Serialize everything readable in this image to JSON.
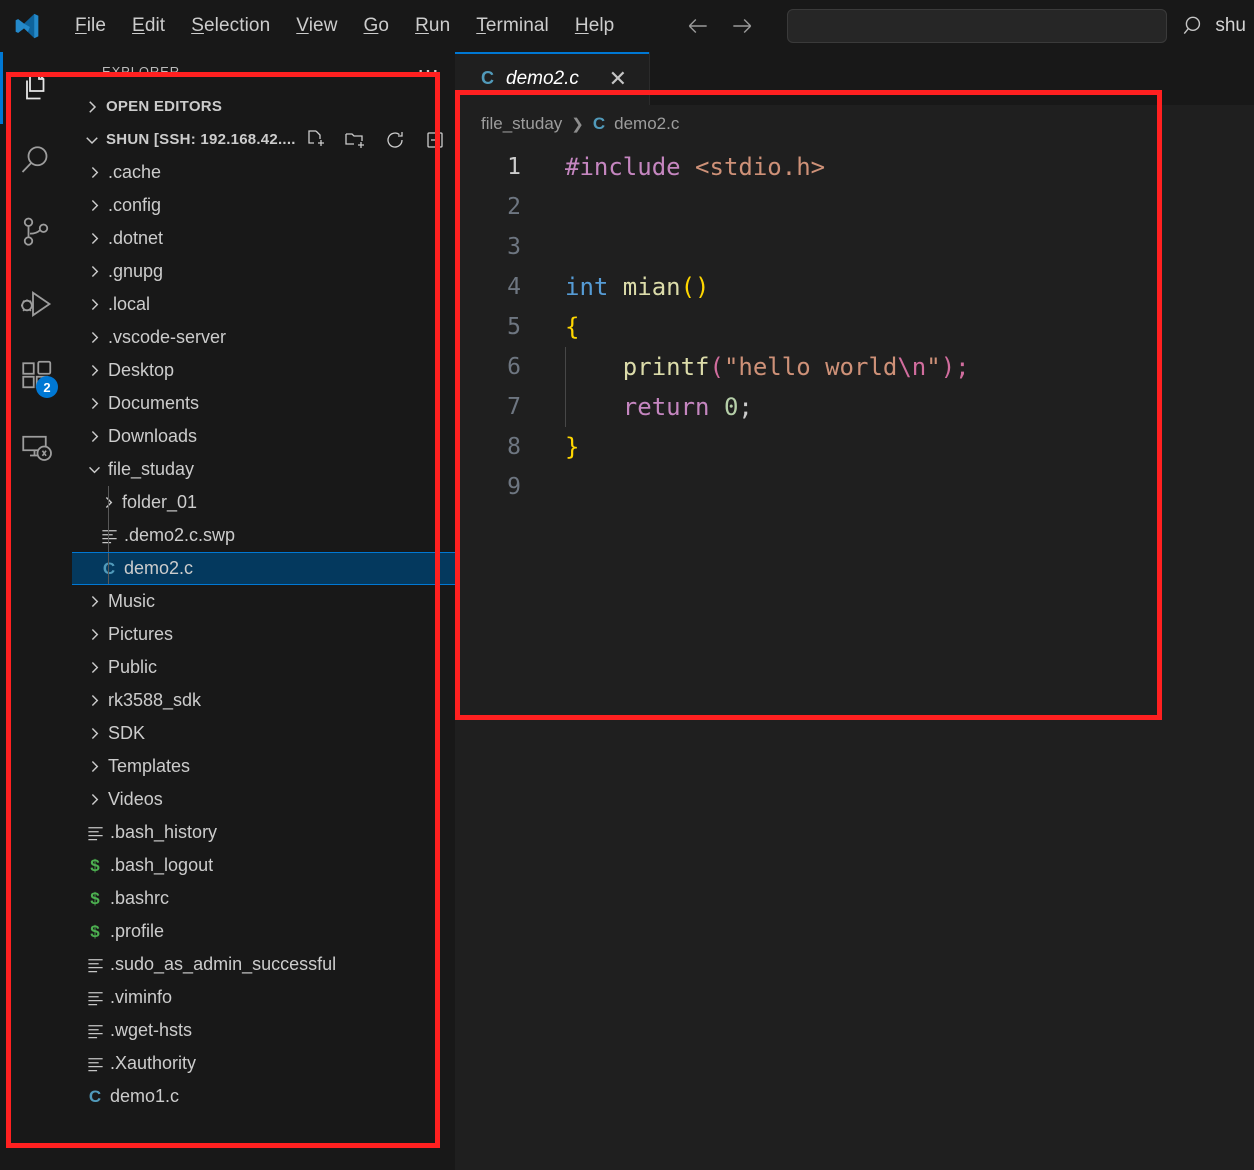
{
  "titlebar": {
    "logo_icon": "vscode-logo-icon",
    "menu": [
      {
        "pre": "",
        "accel": "F",
        "post": "ile"
      },
      {
        "pre": "",
        "accel": "E",
        "post": "dit"
      },
      {
        "pre": "",
        "accel": "S",
        "post": "election"
      },
      {
        "pre": "",
        "accel": "V",
        "post": "iew"
      },
      {
        "pre": "",
        "accel": "G",
        "post": "o"
      },
      {
        "pre": "",
        "accel": "R",
        "post": "un"
      },
      {
        "pre": "",
        "accel": "T",
        "post": "erminal"
      },
      {
        "pre": "",
        "accel": "H",
        "post": "elp"
      }
    ],
    "back_icon": "arrow-left-icon",
    "forward_icon": "arrow-right-icon",
    "quickinput_placeholder": "",
    "quickinput_value": "",
    "search_icon": "search-icon",
    "search_label": "shu"
  },
  "activitybar": {
    "items": [
      {
        "name": "explorer",
        "icon": "files-icon",
        "active": true,
        "badge": ""
      },
      {
        "name": "search",
        "icon": "search-icon",
        "active": false,
        "badge": ""
      },
      {
        "name": "source-control",
        "icon": "source-control-icon",
        "active": false,
        "badge": ""
      },
      {
        "name": "run-and-debug",
        "icon": "run-debug-icon",
        "active": false,
        "badge": ""
      },
      {
        "name": "extensions",
        "icon": "extensions-icon",
        "active": false,
        "badge": "2"
      },
      {
        "name": "remote-explorer",
        "icon": "remote-explorer-icon",
        "active": false,
        "badge": ""
      }
    ]
  },
  "sidebar": {
    "title": "EXPLORER",
    "more_actions_icon": "ellipsis-icon",
    "sections": [
      {
        "label": "OPEN EDITORS",
        "expanded": false
      },
      {
        "label": "SHUN [SSH: 192.168.42....",
        "expanded": true,
        "actions": [
          "new-file-icon",
          "new-folder-icon",
          "refresh-icon",
          "collapse-all-icon"
        ]
      }
    ],
    "tree": [
      {
        "label": ".cache",
        "type": "folder",
        "depth": 1,
        "expanded": false,
        "selected": false
      },
      {
        "label": ".config",
        "type": "folder",
        "depth": 1,
        "expanded": false,
        "selected": false
      },
      {
        "label": ".dotnet",
        "type": "folder",
        "depth": 1,
        "expanded": false,
        "selected": false
      },
      {
        "label": ".gnupg",
        "type": "folder",
        "depth": 1,
        "expanded": false,
        "selected": false
      },
      {
        "label": ".local",
        "type": "folder",
        "depth": 1,
        "expanded": false,
        "selected": false
      },
      {
        "label": ".vscode-server",
        "type": "folder",
        "depth": 1,
        "expanded": false,
        "selected": false
      },
      {
        "label": "Desktop",
        "type": "folder",
        "depth": 1,
        "expanded": false,
        "selected": false
      },
      {
        "label": "Documents",
        "type": "folder",
        "depth": 1,
        "expanded": false,
        "selected": false
      },
      {
        "label": "Downloads",
        "type": "folder",
        "depth": 1,
        "expanded": false,
        "selected": false
      },
      {
        "label": "file_studay",
        "type": "folder",
        "depth": 1,
        "expanded": true,
        "selected": false
      },
      {
        "label": "folder_01",
        "type": "folder",
        "depth": 2,
        "expanded": false,
        "selected": false,
        "guide": true
      },
      {
        "label": ".demo2.c.swp",
        "type": "text",
        "depth": 2,
        "selected": false,
        "guide": true
      },
      {
        "label": "demo2.c",
        "type": "c",
        "depth": 2,
        "selected": true,
        "guide": true
      },
      {
        "label": "Music",
        "type": "folder",
        "depth": 1,
        "expanded": false,
        "selected": false
      },
      {
        "label": "Pictures",
        "type": "folder",
        "depth": 1,
        "expanded": false,
        "selected": false
      },
      {
        "label": "Public",
        "type": "folder",
        "depth": 1,
        "expanded": false,
        "selected": false
      },
      {
        "label": "rk3588_sdk",
        "type": "folder",
        "depth": 1,
        "expanded": false,
        "selected": false
      },
      {
        "label": "SDK",
        "type": "folder",
        "depth": 1,
        "expanded": false,
        "selected": false
      },
      {
        "label": "Templates",
        "type": "folder",
        "depth": 1,
        "expanded": false,
        "selected": false
      },
      {
        "label": "Videos",
        "type": "folder",
        "depth": 1,
        "expanded": false,
        "selected": false
      },
      {
        "label": ".bash_history",
        "type": "text",
        "depth": 1,
        "selected": false
      },
      {
        "label": ".bash_logout",
        "type": "shell",
        "depth": 1,
        "selected": false
      },
      {
        "label": ".bashrc",
        "type": "shell",
        "depth": 1,
        "selected": false
      },
      {
        "label": ".profile",
        "type": "shell",
        "depth": 1,
        "selected": false
      },
      {
        "label": ".sudo_as_admin_successful",
        "type": "text",
        "depth": 1,
        "selected": false
      },
      {
        "label": ".viminfo",
        "type": "text",
        "depth": 1,
        "selected": false
      },
      {
        "label": ".wget-hsts",
        "type": "text",
        "depth": 1,
        "selected": false
      },
      {
        "label": ".Xauthority",
        "type": "text",
        "depth": 1,
        "selected": false
      },
      {
        "label": "demo1.c",
        "type": "c",
        "depth": 1,
        "selected": false
      }
    ]
  },
  "editor": {
    "tab": {
      "label": "demo2.c",
      "icon": "c-file-icon",
      "close_icon": "close-icon",
      "preview": true
    },
    "breadcrumb": [
      {
        "label": "file_studay",
        "icon": ""
      },
      {
        "label": "demo2.c",
        "icon": "c-file-icon"
      }
    ],
    "filename": "demo2.c",
    "language": "c",
    "active_line": 1,
    "lines": [
      {
        "n": "1",
        "tokens": [
          {
            "t": "#include ",
            "c": "t-pre"
          },
          {
            "t": "<stdio.h>",
            "c": "t-str"
          }
        ]
      },
      {
        "n": "2",
        "tokens": []
      },
      {
        "n": "3",
        "tokens": []
      },
      {
        "n": "4",
        "tokens": [
          {
            "t": "int ",
            "c": "t-kw"
          },
          {
            "t": "mian",
            "c": "t-fn"
          },
          {
            "t": "()",
            "c": "t-brkt"
          }
        ]
      },
      {
        "n": "5",
        "tokens": [
          {
            "t": "{",
            "c": "t-brkt"
          }
        ]
      },
      {
        "n": "6",
        "tokens": [
          {
            "t": "    ",
            "c": "t-punc"
          },
          {
            "t": "printf",
            "c": "t-fn"
          },
          {
            "t": "(",
            "c": "t-magenta"
          },
          {
            "t": "\"hello world",
            "c": "t-str"
          },
          {
            "t": "\\n",
            "c": "t-magenta"
          },
          {
            "t": "\"",
            "c": "t-str"
          },
          {
            "t": ")",
            "c": "t-magenta"
          },
          {
            "t": ";",
            "c": "t-magenta"
          }
        ]
      },
      {
        "n": "7",
        "tokens": [
          {
            "t": "    ",
            "c": "t-punc"
          },
          {
            "t": "return ",
            "c": "t-ctl"
          },
          {
            "t": "0",
            "c": "t-num"
          },
          {
            "t": ";",
            "c": "t-punc"
          }
        ]
      },
      {
        "n": "8",
        "tokens": [
          {
            "t": "}",
            "c": "t-brkt"
          }
        ]
      },
      {
        "n": "9",
        "tokens": []
      }
    ]
  },
  "annotations": {
    "sidebar_highlight": "red-rectangle-sidebar",
    "editor_highlight": "red-rectangle-editor",
    "color": "#ff2020"
  }
}
